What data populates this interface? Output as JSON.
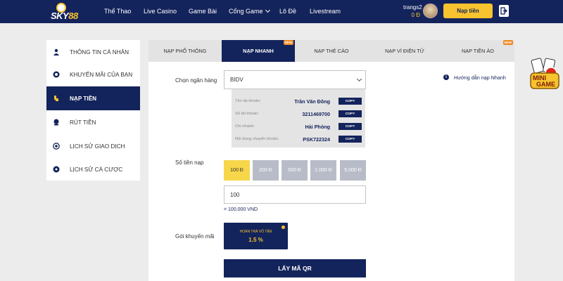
{
  "header": {
    "logo_text_1": "SKY",
    "logo_text_2": "88",
    "nav": [
      "Thể Thao",
      "Live Casino",
      "Game Bài",
      "Cổng Game",
      "Lô Đề",
      "Livestream"
    ],
    "username": "trangs2",
    "balance": "0 Đ",
    "deposit_button": "Nạp tiền",
    "logout_icon": "logout-icon"
  },
  "sidebar": {
    "items": [
      {
        "label": "THÔNG TIN CÁ NHÂN",
        "icon": "user-icon"
      },
      {
        "label": "KHUYẾN MÃI CỦA BẠN",
        "icon": "gift-icon"
      },
      {
        "label": "NẠP TIỀN",
        "icon": "deposit-icon",
        "active": true
      },
      {
        "label": "RÚT TIỀN",
        "icon": "withdraw-icon"
      },
      {
        "label": "LỊCH SỬ GIAO DỊCH",
        "icon": "history-icon"
      },
      {
        "label": "LỊCH SỬ CÁ CƯỢC",
        "icon": "ball-icon"
      }
    ]
  },
  "tabs": [
    {
      "label": "NẠP PHỔ THÔNG"
    },
    {
      "label": "NẠP NHANH",
      "badge": "NEW",
      "active": true
    },
    {
      "label": "NẠP THẺ CÀO"
    },
    {
      "label": "NẠP VÍ ĐIỆN TỬ"
    },
    {
      "label": "NẠP TIỀN ẢO",
      "badge": "NEW"
    }
  ],
  "form": {
    "bank_label": "Chọn ngân hàng",
    "bank_value": "BIDV",
    "guide_icon": "i",
    "guide_text": "Hướng dẫn nạp Nhanh",
    "bank_rows": [
      {
        "key": "Tên tài khoản:",
        "value": "Trần Văn Đông",
        "copy": "COPY"
      },
      {
        "key": "Số tài khoản:",
        "value": "3211469700",
        "copy": "COPY"
      },
      {
        "key": "Chi nhánh:",
        "value": "Hải Phòng",
        "copy": "COPY"
      },
      {
        "key": "Nội dung chuyển khoản:",
        "value": "PSK722324",
        "copy": "COPY"
      }
    ],
    "amount_label": "Số tiền nạp",
    "amount_options": [
      "100 Đ",
      "200 Đ",
      "500 Đ",
      "1.000 Đ",
      "5.000 Đ"
    ],
    "amount_selected_index": 0,
    "amount_value": "100",
    "amount_converted": "= 100,000 VND",
    "promo_label": "Gói khuyến mãi",
    "promo_title": "HOÀN TRẢ VÔ TẬN",
    "promo_rate": "1.5 %",
    "qr_button": "LẤY MÃ QR"
  },
  "widget": {
    "minigame_label_1": "MINI",
    "minigame_label_2": "GAME"
  },
  "colors": {
    "navy": "#13235b",
    "gold": "#f7c32e",
    "orange": "#f08a24"
  }
}
